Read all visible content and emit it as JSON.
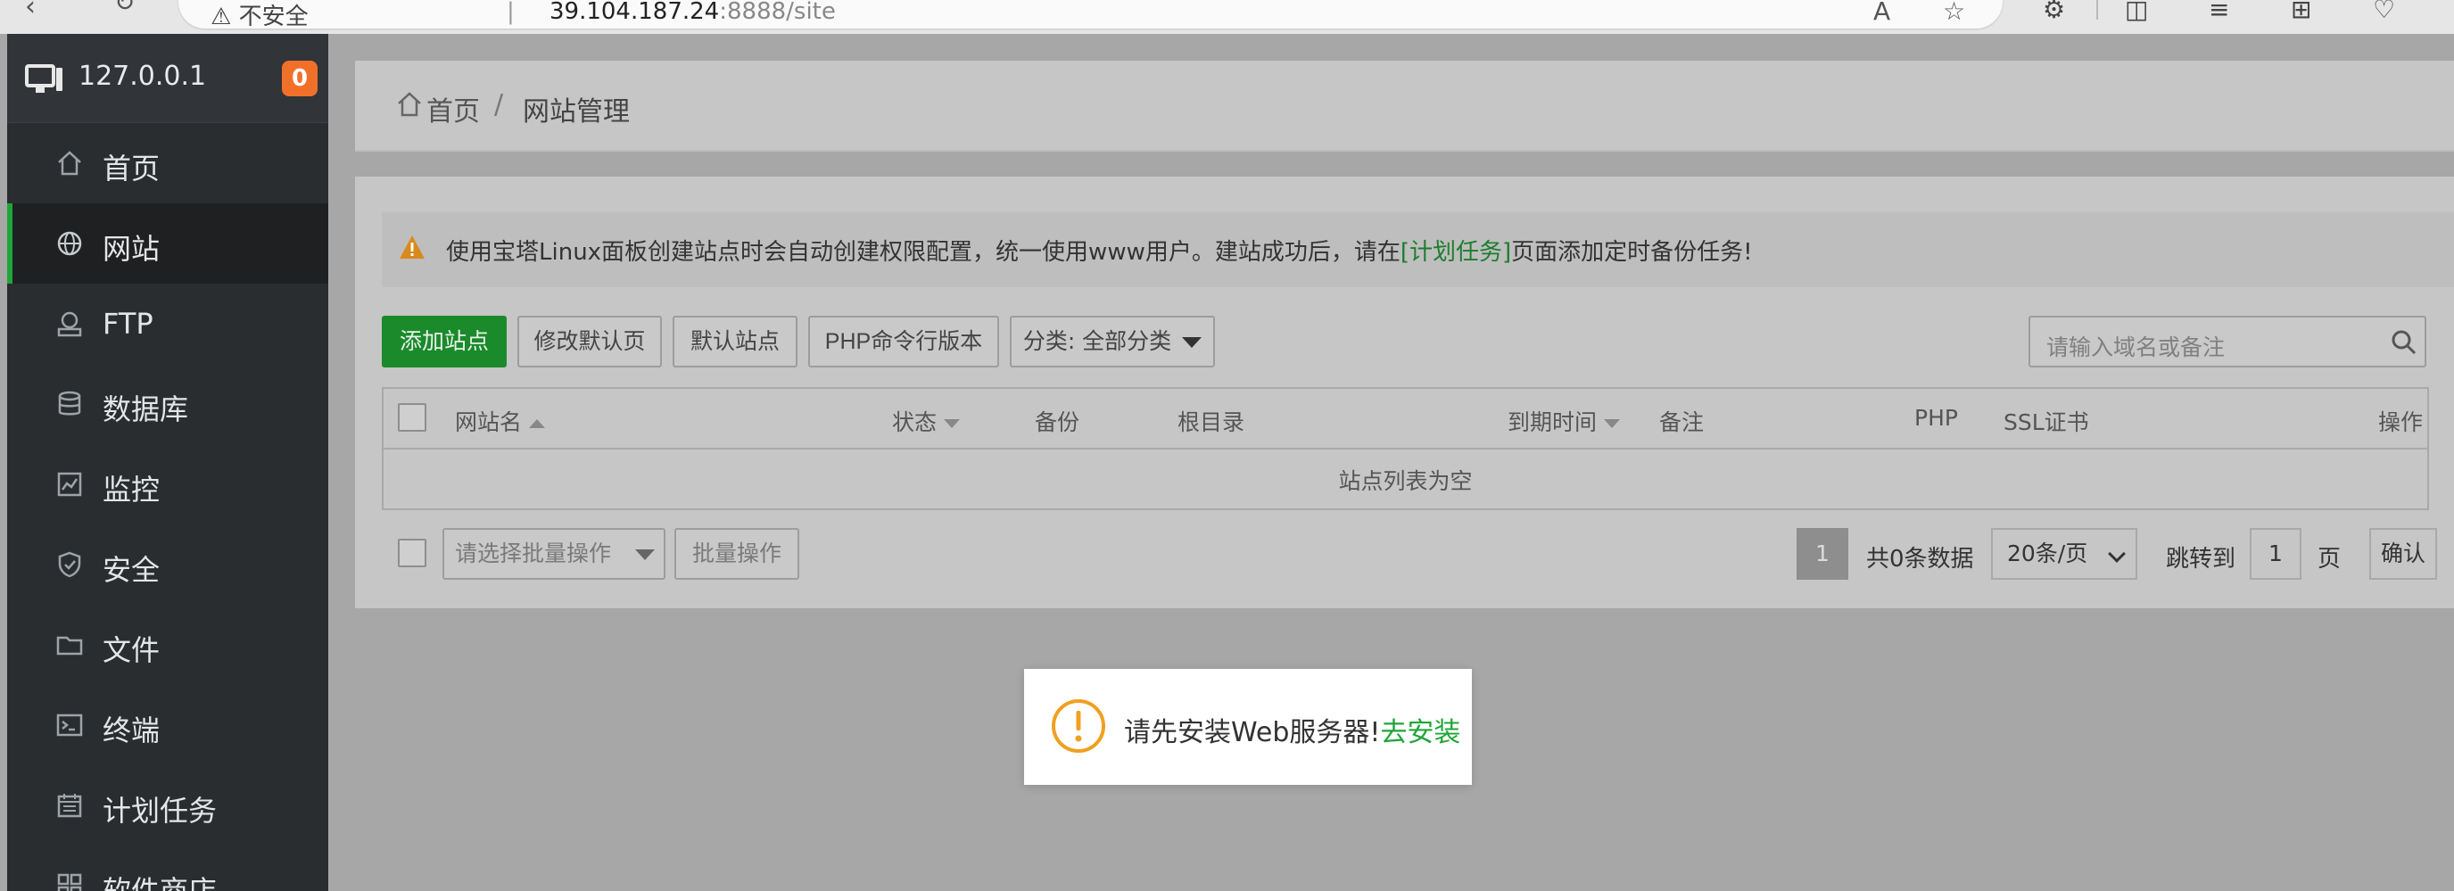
{
  "browser": {
    "security_label": "不安全",
    "url_host": "39.104.187.24",
    "url_rest": ":8888/site"
  },
  "sidebar": {
    "server_ip": "127.0.0.1",
    "notification_count": "0",
    "items": [
      {
        "label": "首页",
        "icon": "home-icon"
      },
      {
        "label": "网站",
        "icon": "globe-icon",
        "active": true
      },
      {
        "label": "FTP",
        "icon": "ftp-icon"
      },
      {
        "label": "数据库",
        "icon": "database-icon"
      },
      {
        "label": "监控",
        "icon": "monitor-chart-icon"
      },
      {
        "label": "安全",
        "icon": "shield-icon"
      },
      {
        "label": "文件",
        "icon": "folder-icon"
      },
      {
        "label": "终端",
        "icon": "terminal-icon"
      },
      {
        "label": "计划任务",
        "icon": "calendar-icon"
      },
      {
        "label": "软件商店",
        "icon": "apps-icon"
      }
    ]
  },
  "breadcrumb": {
    "home": "首页",
    "separator": "/",
    "current": "网站管理"
  },
  "alert": {
    "text_before": "使用宝塔Linux面板创建站点时会自动创建权限配置，统一使用www用户。建站成功后，请在",
    "link": "[计划任务]",
    "text_after": "页面添加定时备份任务!"
  },
  "toolbar": {
    "add_site": "添加站点",
    "modify_default_page": "修改默认页",
    "default_site": "默认站点",
    "php_cli_version": "PHP命令行版本",
    "category": "分类: 全部分类",
    "search_placeholder": "请输入域名或备注"
  },
  "table": {
    "columns": [
      "网站名",
      "状态",
      "备份",
      "根目录",
      "到期时间",
      "备注",
      "PHP",
      "SSL证书",
      "操作"
    ],
    "empty_text": "站点列表为空"
  },
  "footer": {
    "batch_placeholder": "请选择批量操作",
    "batch_button": "批量操作",
    "current_page": "1",
    "total": "共0条数据",
    "page_size": "20条/页",
    "jump_label": "跳转到",
    "jump_value": "1",
    "page_unit": "页",
    "confirm": "确认"
  },
  "toast": {
    "message": "请先安装Web服务器!",
    "link": "去安装"
  },
  "colors": {
    "accent_green": "#20a53a",
    "badge_orange": "#f0702a",
    "warning_orange": "#f0a020"
  }
}
